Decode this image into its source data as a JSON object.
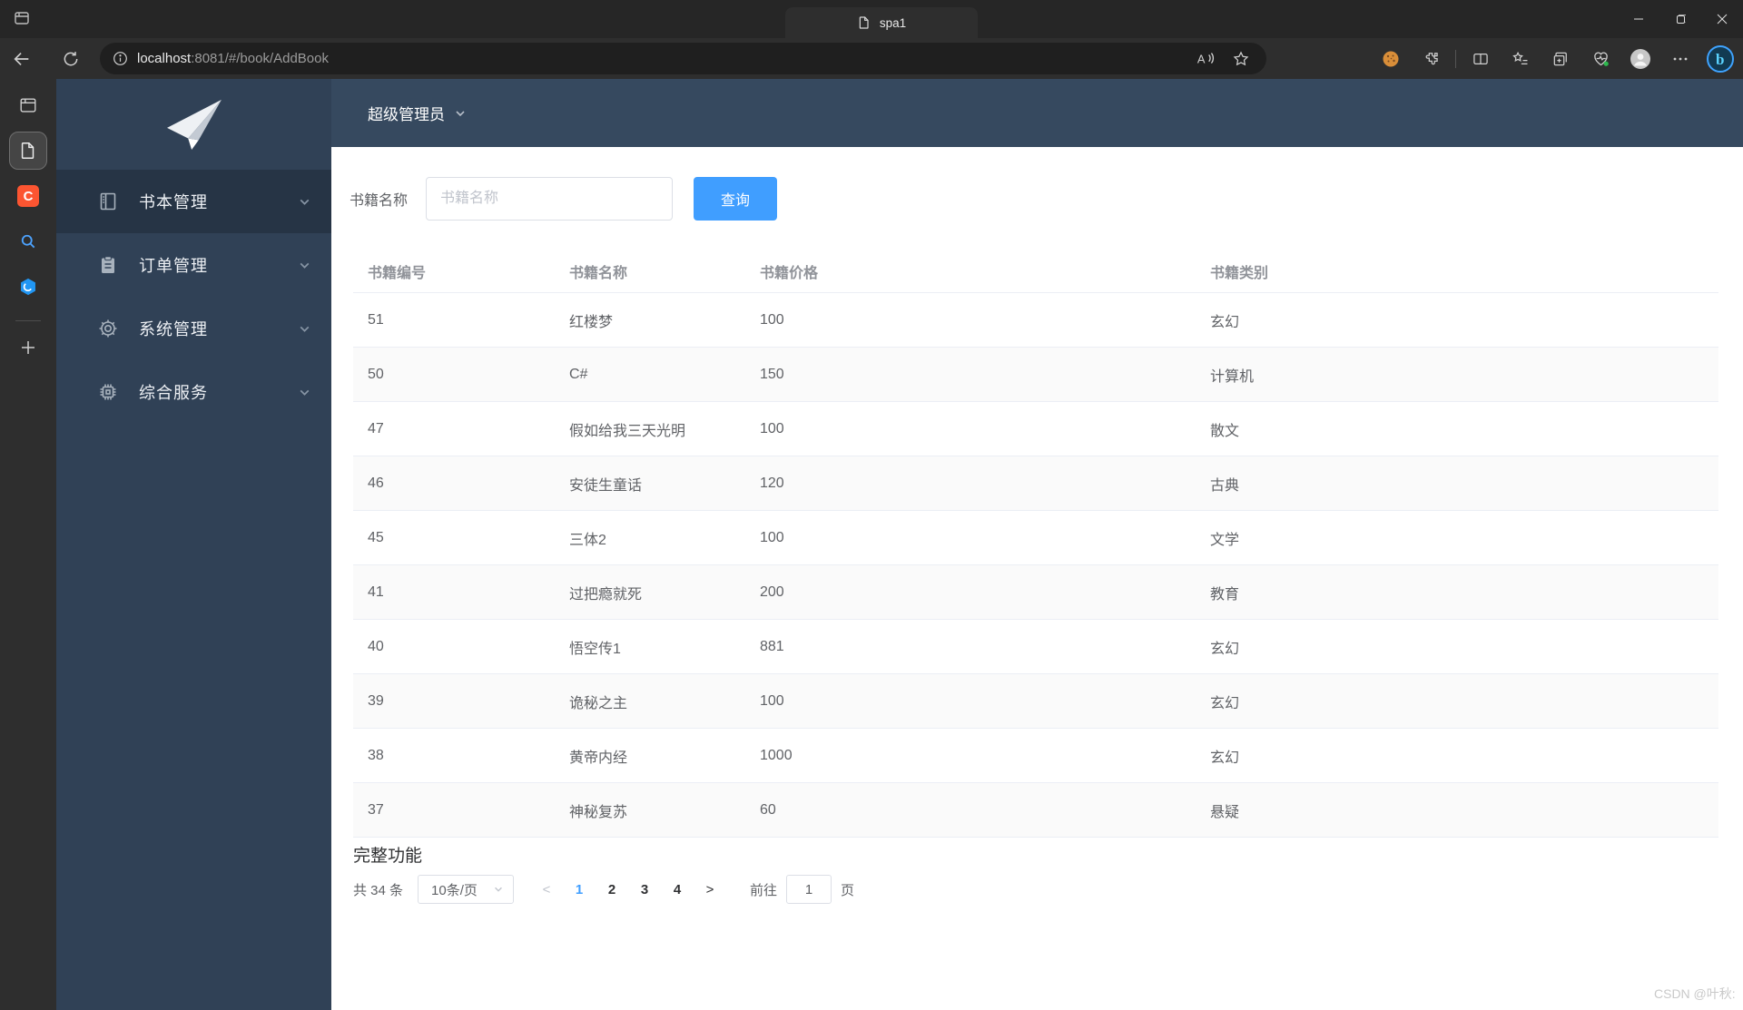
{
  "browser": {
    "tab_title": "spa1",
    "url_host": "localhost",
    "url_path": ":8081/#/book/AddBook"
  },
  "sidebar": {
    "items": [
      {
        "label": "书本管理",
        "icon": "book-icon"
      },
      {
        "label": "订单管理",
        "icon": "clipboard-icon"
      },
      {
        "label": "系统管理",
        "icon": "gear-icon"
      },
      {
        "label": "综合服务",
        "icon": "chip-icon"
      }
    ]
  },
  "header": {
    "user": "超级管理员"
  },
  "search": {
    "label": "书籍名称",
    "placeholder": "书籍名称",
    "button": "查询"
  },
  "table": {
    "columns": [
      "书籍编号",
      "书籍名称",
      "书籍价格",
      "书籍类别"
    ],
    "rows": [
      [
        "51",
        "红楼梦",
        "100",
        "玄幻"
      ],
      [
        "50",
        "C#",
        "150",
        "计算机"
      ],
      [
        "47",
        "假如给我三天光明",
        "100",
        "散文"
      ],
      [
        "46",
        "安徒生童话",
        "120",
        "古典"
      ],
      [
        "45",
        "三体2",
        "100",
        "文学"
      ],
      [
        "41",
        "过把瘾就死",
        "200",
        "教育"
      ],
      [
        "40",
        "悟空传1",
        "881",
        "玄幻"
      ],
      [
        "39",
        "诡秘之主",
        "100",
        "玄幻"
      ],
      [
        "38",
        "黄帝内经",
        "1000",
        "玄幻"
      ],
      [
        "37",
        "神秘复苏",
        "60",
        "悬疑"
      ]
    ]
  },
  "footer": {
    "section_title": "完整功能",
    "pagination": {
      "total": "共 34 条",
      "page_size": "10条/页",
      "prev": "<",
      "next": ">",
      "pages": [
        "1",
        "2",
        "3",
        "4"
      ],
      "active_page": "1",
      "goto_label": "前往",
      "goto_value": "1",
      "goto_suffix": "页"
    }
  },
  "watermark": "CSDN @叶秋:",
  "colors": {
    "accent_blue": "#409eff",
    "sidebar_bg": "#304156",
    "sidebar_active_bg": "#263445",
    "app_header_bg": "#36495f",
    "table_stripe": "#fafafa",
    "table_border": "#ebeef5",
    "input_border": "#dcdfe6",
    "text_primary": "#303133",
    "text_regular": "#606266",
    "text_table_header": "#909399",
    "placeholder": "#c0c4cc",
    "csdn_orange": "#fc5531"
  }
}
